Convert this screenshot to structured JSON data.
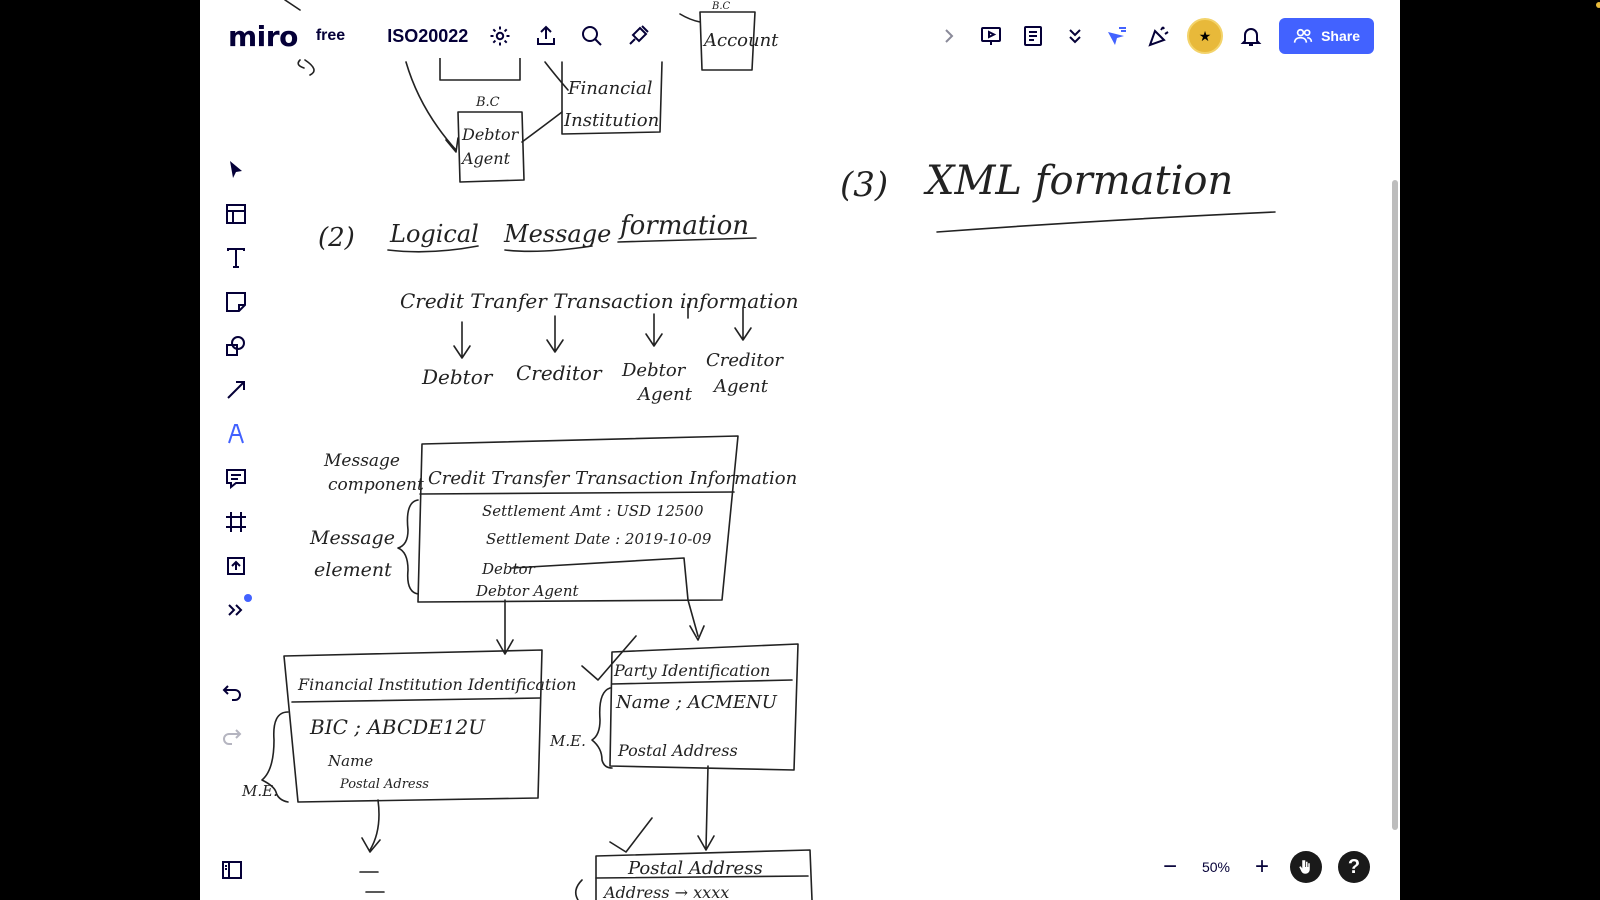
{
  "header": {
    "logo": "miro",
    "plan": "free",
    "board_name": "ISO20022",
    "share_label": "Share"
  },
  "zoom": {
    "level": "50%",
    "minus": "−",
    "plus": "+",
    "help": "?"
  },
  "toolbar": {
    "tools": [
      "select",
      "templates",
      "text",
      "sticky-note",
      "shapes",
      "connection-line",
      "pen",
      "comment",
      "frame",
      "upload",
      "more-tools"
    ]
  },
  "board": {
    "top_fragments": {
      "bc_top": "B.C",
      "account": "Account",
      "financial": "Financial",
      "institution": "Institution",
      "bc": "B.C",
      "debtor": "Debtor",
      "agent": "Agent"
    },
    "section2": {
      "number": "(2)",
      "w1": "Logical",
      "w2": "Message",
      "w3": "formation"
    },
    "section3": {
      "number": "(3)",
      "title": "XML formation"
    },
    "cti_heading": "Credit Tranfer Transaction information",
    "cti_children": [
      {
        "line1": "Debtor",
        "line2": ""
      },
      {
        "line1": "Creditor",
        "line2": ""
      },
      {
        "line1": "Debtor",
        "line2": "Agent"
      },
      {
        "line1": "Creditor",
        "line2": "Agent"
      }
    ],
    "message_component_label": {
      "line1": "Message",
      "line2": "component"
    },
    "message_element_label": {
      "line1": "Message",
      "line2": "element"
    },
    "main_box": {
      "title": "Credit Transfer Transaction Information",
      "rows": [
        "Settlement Amt : USD 12500",
        "Settlement Date : 2019-10-09",
        "Debtor",
        "Debtor Agent"
      ]
    },
    "fi_box": {
      "title": "Financial Institution Identification",
      "rows": [
        "BIC ; ABCDE12U",
        "Name",
        "Postal Adress"
      ],
      "side_label": "M.E."
    },
    "party_box": {
      "title": "Party Identification",
      "rows": [
        "Name ; ACMENU",
        "Postal Address"
      ],
      "side_label": "M.E."
    },
    "postal_box": {
      "title": "Postal Address",
      "row": "Address → xxxx"
    }
  }
}
